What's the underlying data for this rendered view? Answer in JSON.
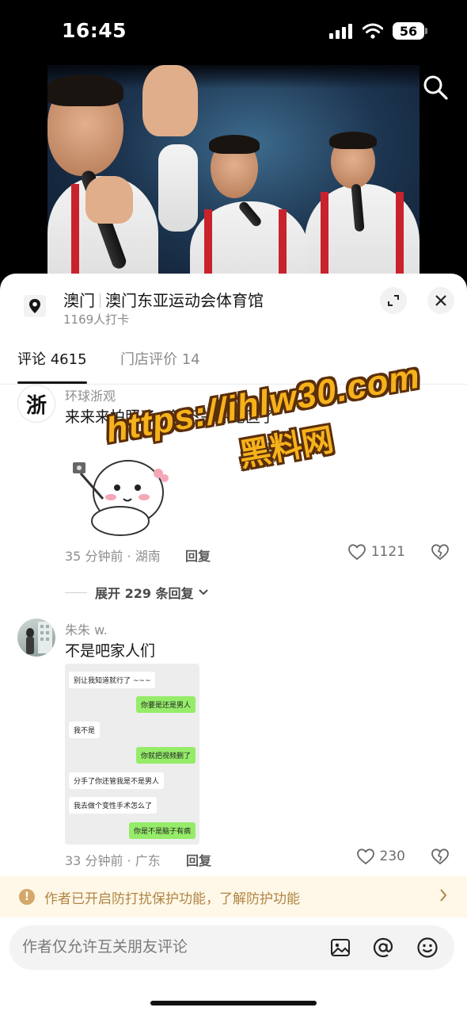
{
  "status_bar": {
    "time": "16:45",
    "battery": "56"
  },
  "location": {
    "city": "澳门",
    "venue": "澳门东亚运动会体育馆",
    "checkins": "1169人打卡"
  },
  "tabs": [
    {
      "label": "评论 4615",
      "active": true
    },
    {
      "label": "门店评价 14",
      "active": false
    }
  ],
  "comments": [
    {
      "user": "环球浙观",
      "avatar_text": "浙",
      "text": "来来来拍照了，等下关评论区了",
      "time_location": "35 分钟前 · 湖南",
      "reply_label": "回复",
      "likes": "1121",
      "expand_label": "展开 229 条回复"
    },
    {
      "user": "朱朱 w.",
      "text": "不是吧家人们",
      "time_location": "33 分钟前 · 广东",
      "reply_label": "回复",
      "likes": "230",
      "chat": [
        {
          "side": "left",
          "text": "别让我知道就行了 ~~~"
        },
        {
          "side": "right",
          "text": "你要是还是男人"
        },
        {
          "side": "left",
          "text": "我不是"
        },
        {
          "side": "right",
          "text": "你就把视频删了"
        },
        {
          "side": "left",
          "text": "分手了你还管我是不是男人"
        },
        {
          "side": "left",
          "text": "我去做个变性手术怎么了"
        },
        {
          "side": "right",
          "text": "你是不是脑子有病"
        }
      ]
    }
  ],
  "notice": {
    "text": "作者已开启防打扰保护功能，了解防护功能"
  },
  "input": {
    "placeholder": "作者仅允许互关朋友评论"
  },
  "watermark": {
    "line1": "https://ihlw30.com",
    "line2": "黑料网"
  },
  "colors": {
    "accent_notice": "#b08443",
    "wechat_green": "#95ec69",
    "stripe_red": "#c8232c"
  }
}
